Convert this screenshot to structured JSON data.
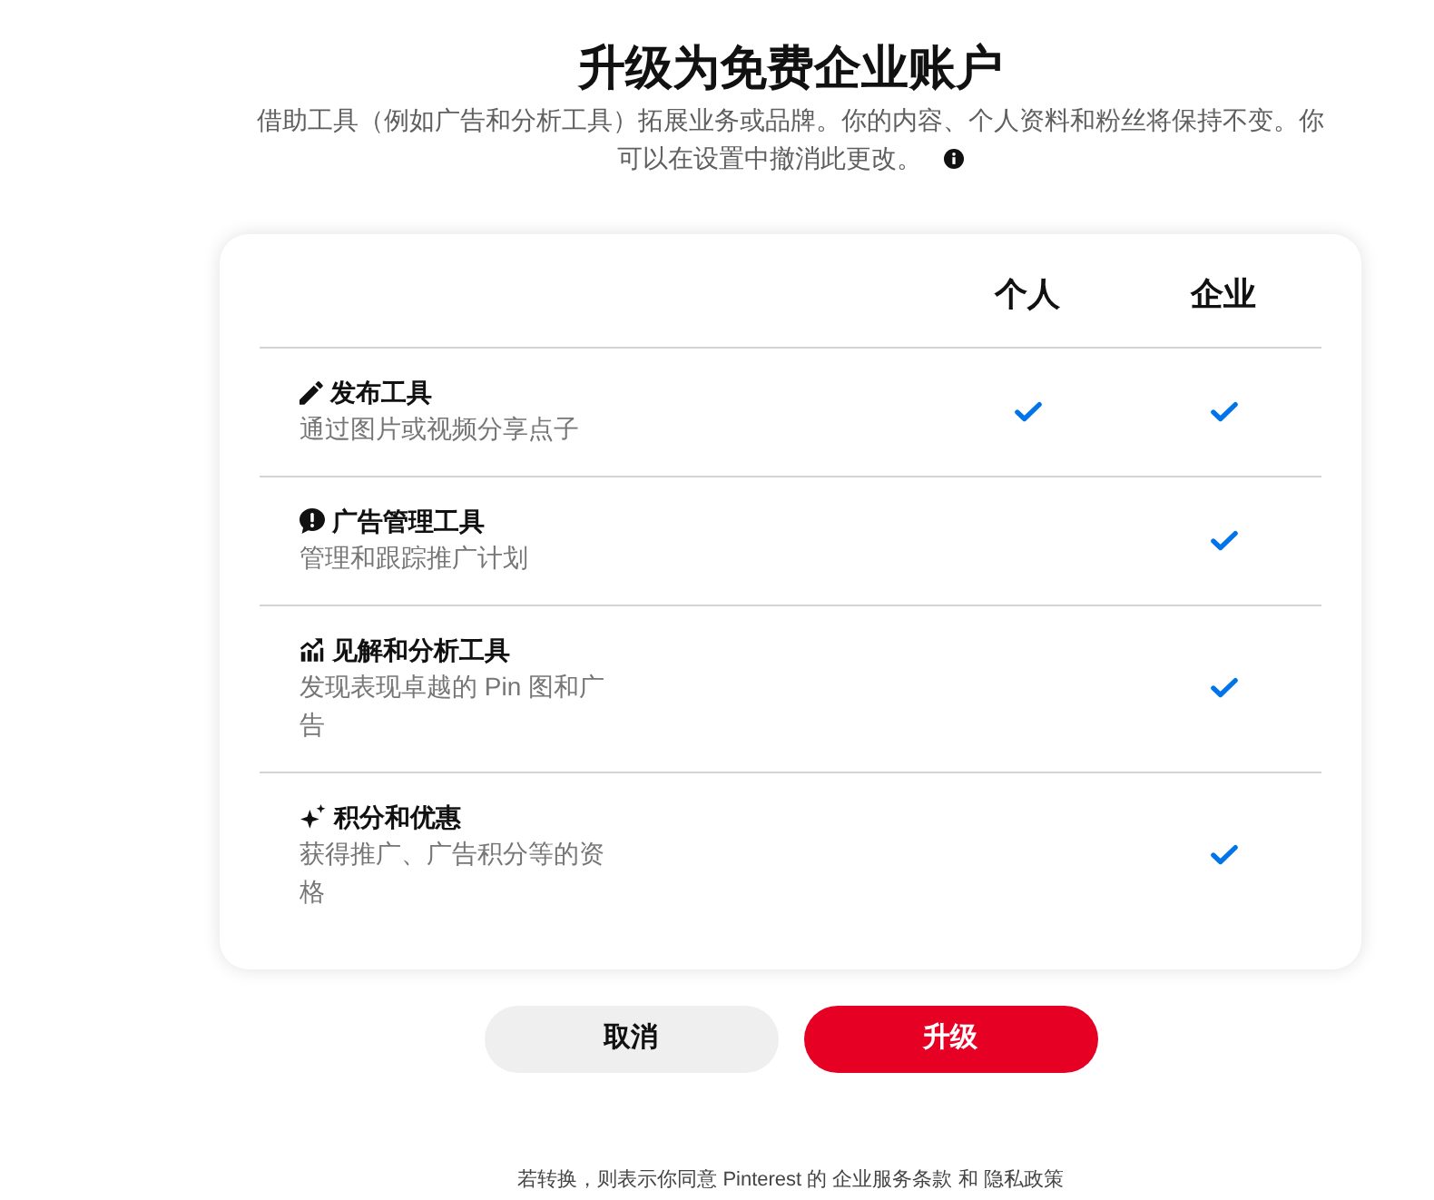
{
  "header": {
    "title": "升级为免费企业账户",
    "subtitle_lines": [
      "借助工具（例如广告和分析工具）拓展业务或品牌。你的内容、个人资料和粉丝将保持不变。你",
      "可以在设置中撤消此更改。"
    ]
  },
  "comparison": {
    "columns": [
      "个人",
      "企业"
    ],
    "features": [
      {
        "kind": "pencil",
        "title": "发布工具",
        "description": "通过图片或视频分享点子",
        "personal": true,
        "business": true
      },
      {
        "kind": "ads",
        "title": "广告管理工具",
        "description": "管理和跟踪推广计划",
        "personal": false,
        "business": true
      },
      {
        "kind": "analytics",
        "title": "见解和分析工具",
        "description": "发现表现卓越的 Pin 图和广告",
        "personal": false,
        "business": true
      },
      {
        "kind": "sparkle",
        "title": "积分和优惠",
        "description": "获得推广、广告积分等的资格",
        "personal": false,
        "business": true
      }
    ]
  },
  "buttons": [
    {
      "kind": "secondary",
      "label": "取消"
    },
    {
      "kind": "primary",
      "label": "升级"
    }
  ],
  "footer": {
    "text": "若转换，则表示你同意 Pinterest 的",
    "links": [
      "企业服务条款",
      "隐私政策"
    ],
    "joiner": "和"
  }
}
